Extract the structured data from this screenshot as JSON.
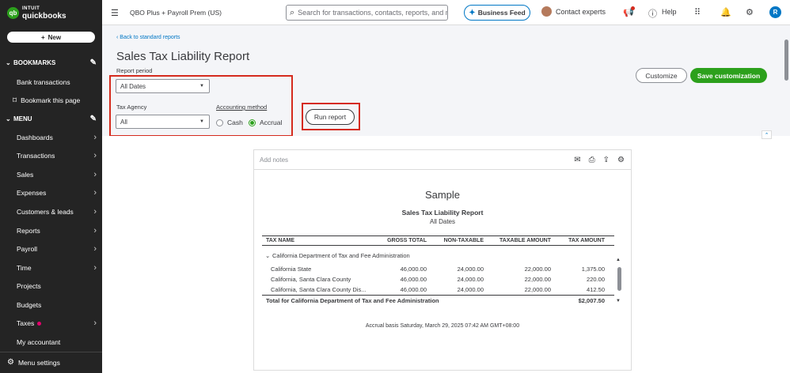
{
  "brand": {
    "top": "INTUIT",
    "bottom": "quickbooks"
  },
  "sidebar": {
    "new_label": "New",
    "bookmarks_label": "BOOKMARKS",
    "bookmarks": [
      "Bank transactions",
      "Bookmark this page"
    ],
    "menu_label": "MENU",
    "menu_items": [
      {
        "label": "Dashboards"
      },
      {
        "label": "Transactions"
      },
      {
        "label": "Sales"
      },
      {
        "label": "Expenses"
      },
      {
        "label": "Customers & leads"
      },
      {
        "label": "Reports"
      },
      {
        "label": "Payroll"
      },
      {
        "label": "Time"
      },
      {
        "label": "Projects"
      },
      {
        "label": "Budgets"
      },
      {
        "label": "Taxes"
      },
      {
        "label": "My accountant"
      }
    ],
    "menu_settings": "Menu settings"
  },
  "topbar": {
    "company": "QBO Plus + Payroll Prem (US)",
    "search_placeholder": "Search for transactions, contacts, reports, and more",
    "business_feed": "Business Feed",
    "contact_experts": "Contact experts",
    "help": "Help",
    "avatar_initial": "R"
  },
  "header": {
    "back_link": "Back to standard reports",
    "title": "Sales Tax Liability Report",
    "report_period_label": "Report period",
    "report_period_value": "All Dates",
    "tax_agency_label": "Tax Agency",
    "tax_agency_value": "All",
    "accounting_method_label": "Accounting method",
    "cash_label": "Cash",
    "accrual_label": "Accrual",
    "run_report": "Run report",
    "customize": "Customize",
    "save_customization": "Save customization"
  },
  "report": {
    "notes_placeholder": "Add notes",
    "company": "Sample",
    "name": "Sales Tax Liability Report",
    "period": "All Dates",
    "columns": [
      "TAX NAME",
      "GROSS TOTAL",
      "NON-TAXABLE",
      "TAXABLE AMOUNT",
      "TAX AMOUNT"
    ],
    "group": "California Department of Tax and Fee Administration",
    "rows": [
      {
        "name": "California State",
        "gross": "46,000.00",
        "nontax": "24,000.00",
        "taxable": "22,000.00",
        "tax": "1,375.00"
      },
      {
        "name": "California, Santa Clara County",
        "gross": "46,000.00",
        "nontax": "24,000.00",
        "taxable": "22,000.00",
        "tax": "220.00"
      },
      {
        "name": "California, Santa Clara County Dis...",
        "gross": "46,000.00",
        "nontax": "24,000.00",
        "taxable": "22,000.00",
        "tax": "412.50"
      }
    ],
    "total_label": "Total for California Department of Tax and Fee Administration",
    "total_value": "$2,007.50",
    "footer": "Accrual basis  Saturday, March 29, 2025  07:42 AM GMT+08:00"
  }
}
